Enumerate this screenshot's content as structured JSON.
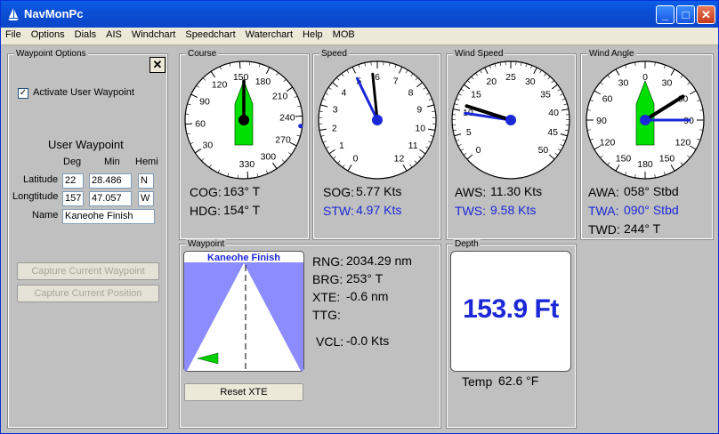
{
  "window": {
    "title": "NavMonPc"
  },
  "menu": [
    "File",
    "Options",
    "Dials",
    "AIS",
    "Windchart",
    "Speedchart",
    "Waterchart",
    "Help",
    "MOB"
  ],
  "waypoint_options": {
    "group_label": "Waypoint Options",
    "close_glyph": "✕",
    "activate_label": "Activate User Waypoint",
    "activate_checked": true,
    "check_glyph": "✓",
    "heading": "User Waypoint",
    "col_deg": "Deg",
    "col_min": "Min",
    "col_hemi": "Hemi",
    "latitude_label": "Latitude",
    "lat_deg": "22",
    "lat_min": "28.486",
    "lat_hemi": "N",
    "longitude_label": "Longtitude",
    "lon_deg": "157",
    "lon_min": "47.057",
    "lon_hemi": "W",
    "name_label": "Name",
    "name_value": "Kaneohe Finish",
    "capture_waypoint": "Capture Current Waypoint",
    "capture_position": "Capture Current Position"
  },
  "course": {
    "label": "Course",
    "ticks": [
      "330",
      "30",
      "60",
      "90",
      "120",
      "150",
      "180",
      "210",
      "240",
      "270",
      "300"
    ],
    "cog_label": "COG:",
    "cog_value": "163° T",
    "hdg_label": "HDG:",
    "hdg_value": "154° T",
    "heading_deg": 154,
    "cog_deg": 163,
    "mark_deg": 250
  },
  "speed": {
    "label": "Speed",
    "ticks": [
      "0",
      "1",
      "2",
      "3",
      "4",
      "5",
      "6",
      "7",
      "8",
      "9",
      "10",
      "11",
      "12"
    ],
    "sog_label": "SOG:",
    "sog_value": "5.77 Kts",
    "stw_label": "STW:",
    "stw_value": "4.97 Kts",
    "sog": 5.77,
    "stw": 4.97
  },
  "wind_speed": {
    "label": "Wind Speed",
    "ticks": [
      "0",
      "5",
      "10",
      "15",
      "20",
      "25",
      "30",
      "35",
      "40",
      "45",
      "50"
    ],
    "aws_label": "AWS:",
    "aws_value": "11.30 Kts",
    "tws_label": "TWS:",
    "tws_value": "9.58 Kts",
    "aws": 11.3,
    "tws": 9.58
  },
  "wind_angle": {
    "label": "Wind Angle",
    "ticks": [
      "180",
      "150",
      "120",
      "90",
      "60",
      "30",
      "0",
      "30",
      "60",
      "90",
      "120",
      "150"
    ],
    "awa_label": "AWA:",
    "awa_value": "058° Stbd",
    "twa_label": "TWA:",
    "twa_value": "090° Stbd",
    "twd_label": "TWD:",
    "twd_value": "244° T",
    "awa": 58,
    "twa": 90
  },
  "waypoint": {
    "label": "Waypoint",
    "name": "Kaneohe Finish",
    "rng_label": "RNG:",
    "rng_value": "2034.29 nm",
    "brg_label": "BRG:",
    "brg_value": "253° T",
    "xte_label": "XTE:",
    "xte_value": "-0.6 nm",
    "ttg_label": "TTG:",
    "ttg_value": "",
    "vcl_label": "VCL:",
    "vcl_value": "-0.0 Kts",
    "reset_label": "Reset XTE"
  },
  "depth": {
    "label": "Depth",
    "value": "153.9 Ft",
    "temp_label": "Temp",
    "temp_value": "62.6 °F"
  },
  "colors": {
    "accent_blue": "#1a28d8",
    "boat_green": "#00e000",
    "water": "#8c8cff"
  }
}
